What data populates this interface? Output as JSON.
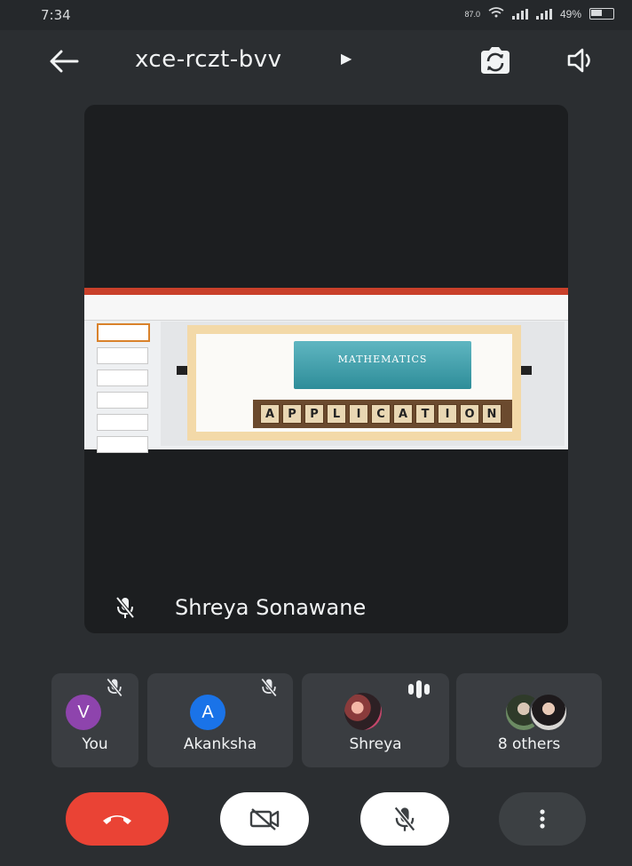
{
  "status_bar": {
    "time": "7:34",
    "net_speed": "87.0",
    "battery": "49%"
  },
  "header": {
    "meeting_code": "xce-rczt-bvv"
  },
  "stage": {
    "presenter_name": "Shreya Sonawane",
    "slide_title": "MATHEMATICS",
    "slide_tiles": [
      "A",
      "P",
      "P",
      "L",
      "I",
      "C",
      "A",
      "T",
      "I",
      "O",
      "N"
    ]
  },
  "participants": [
    {
      "label": "You",
      "initial": "V",
      "color": "#8e44ad"
    },
    {
      "label": "Akanksha",
      "initial": "A",
      "color": "#1a73e8"
    },
    {
      "label": "Shreya"
    },
    {
      "label": "8 others"
    }
  ],
  "colors": {
    "end_call": "#ea4335",
    "light_button": "#ffffff",
    "more_button": "#3c4043"
  }
}
